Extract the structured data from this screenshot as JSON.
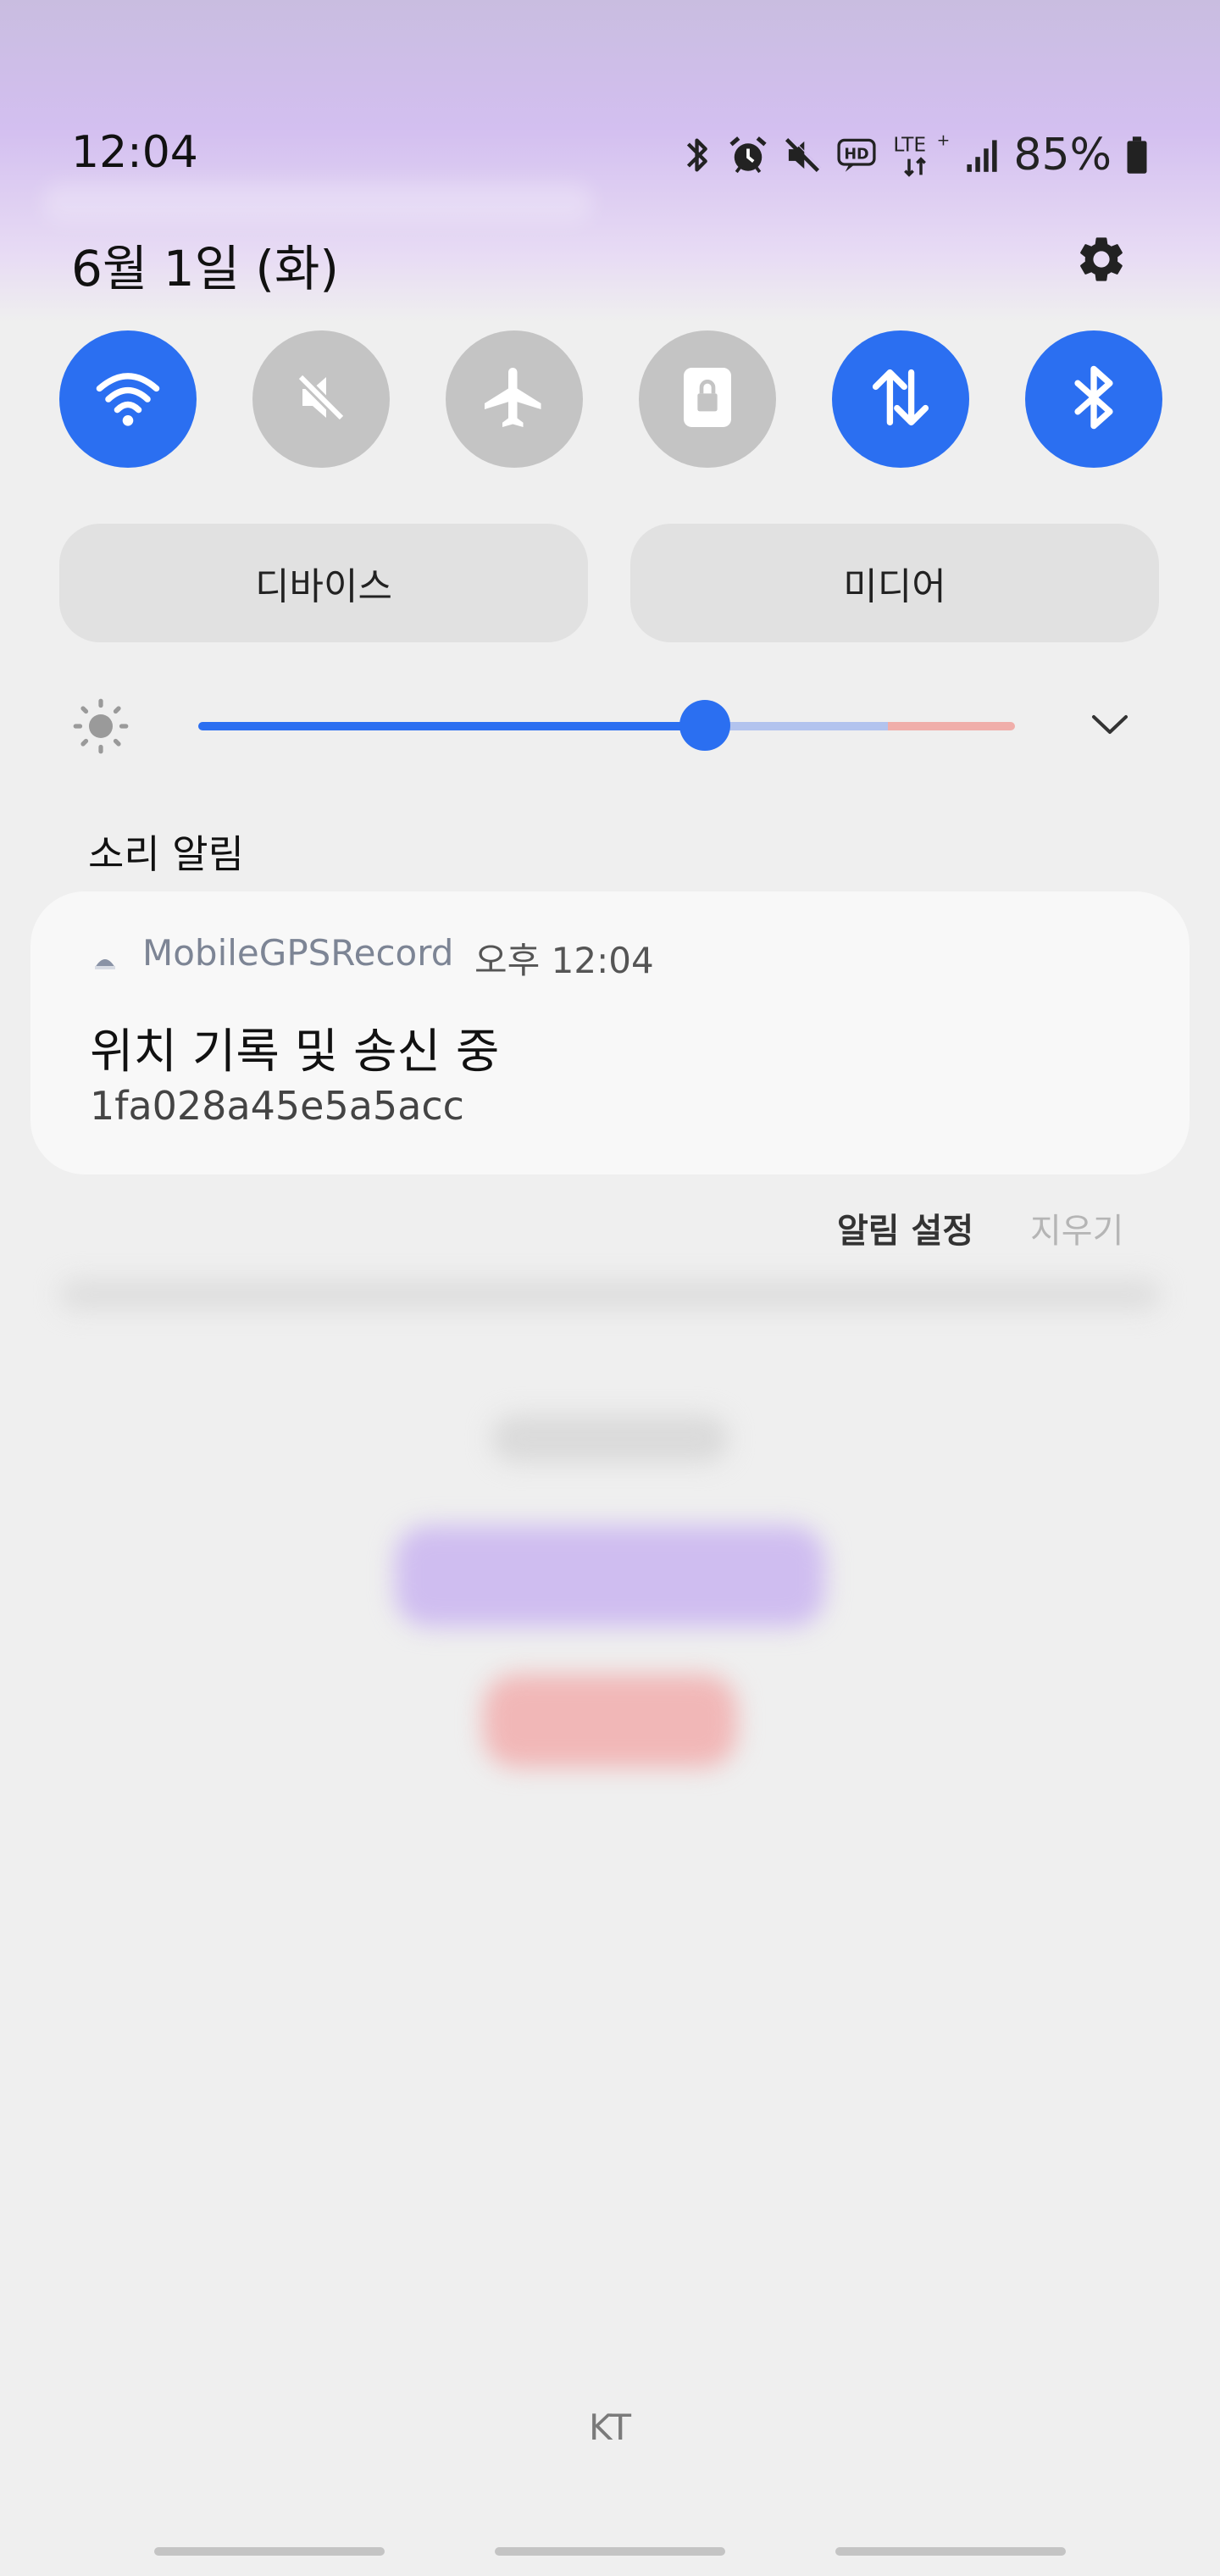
{
  "status_bar": {
    "time": "12:04",
    "battery": "85%",
    "icons": [
      "bluetooth-icon",
      "alarm-icon",
      "mute-icon",
      "hd-voice-icon",
      "lte-plus-icon",
      "signal-icon",
      "battery-icon"
    ]
  },
  "header": {
    "date": "6월 1일 (화)",
    "settings_icon": "gear-icon"
  },
  "quick_toggles": [
    {
      "name": "wifi",
      "icon": "wifi-icon",
      "on": true
    },
    {
      "name": "sound",
      "icon": "mute-icon",
      "on": false
    },
    {
      "name": "airplane",
      "icon": "airplane-icon",
      "on": false
    },
    {
      "name": "lock-rotation",
      "icon": "lock-icon",
      "on": false
    },
    {
      "name": "mobile-data",
      "icon": "data-transfer-icon",
      "on": true
    },
    {
      "name": "bluetooth",
      "icon": "bluetooth-icon",
      "on": true
    }
  ],
  "buttons": {
    "device": "디바이스",
    "media": "미디어"
  },
  "brightness": {
    "level": 0.62,
    "icon": "sun-icon",
    "expand_icon": "chevron-down-icon"
  },
  "notifications": {
    "section_label": "소리 알림",
    "item": {
      "app_name": "MobileGPSRecord",
      "time": "오후 12:04",
      "title": "위치 기록 및 송신 중",
      "text": "1fa028a45e5a5acc"
    },
    "actions": {
      "settings": "알림 설정",
      "clear": "지우기"
    }
  },
  "footer": {
    "carrier": "KT"
  },
  "colors": {
    "accent": "#2b6ff1",
    "toggle_off": "#c4c4c4",
    "background": "#efefef"
  }
}
